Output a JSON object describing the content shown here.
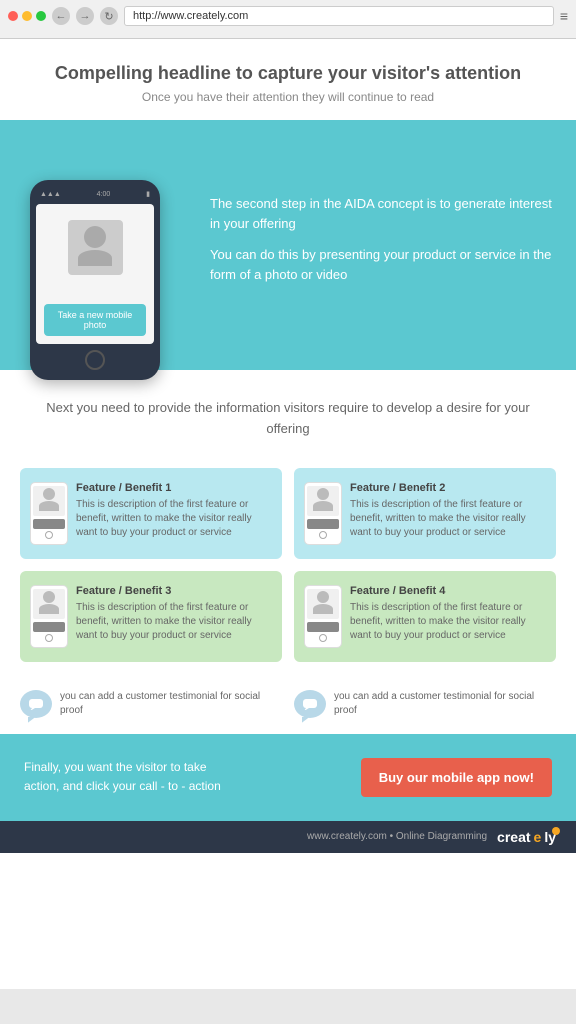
{
  "browser": {
    "url": "http://www.creately.com",
    "back": "←",
    "forward": "→",
    "refresh": "↻"
  },
  "hero": {
    "headline": "Compelling headline to capture your visitor's attention",
    "subtext": "Once you have their attention they will continue to read"
  },
  "phone": {
    "status": "4:00",
    "button_label": "Take a new mobile photo"
  },
  "banner": {
    "text1": "The second step in the AIDA concept is to generate interest in your offering",
    "text2": "You can do this by presenting your product or service in the form of a photo or video"
  },
  "desire": {
    "text": "Next you need to provide the information visitors require to develop a desire for your offering"
  },
  "features": [
    {
      "title": "Feature / Benefit 1",
      "description": "This is description of the first feature or benefit, written to make the visitor really want to buy your product or service",
      "color": "blue"
    },
    {
      "title": "Feature / Benefit 2",
      "description": "This is description of the first feature or benefit, written to make the visitor really want to buy your product or service",
      "color": "blue"
    },
    {
      "title": "Feature / Benefit 3",
      "description": "This is description of the first feature or benefit, written to make the visitor really want to buy your product or service",
      "color": "green"
    },
    {
      "title": "Feature / Benefit 4",
      "description": "This is description of the first feature or benefit, written to make the visitor really want to buy your product or service",
      "color": "green"
    }
  ],
  "testimonials": [
    {
      "text": "you can add a customer testimonial for social proof"
    },
    {
      "text": "you can add a customer testimonial for social proof"
    }
  ],
  "cta": {
    "left_text": "Finally, you want the visitor to take action, and click your call - to - action",
    "button_label": "Buy our mobile app now!"
  },
  "footer": {
    "brand_text": "www.creately.com • Online Diagramming",
    "logo_text": "creately"
  }
}
